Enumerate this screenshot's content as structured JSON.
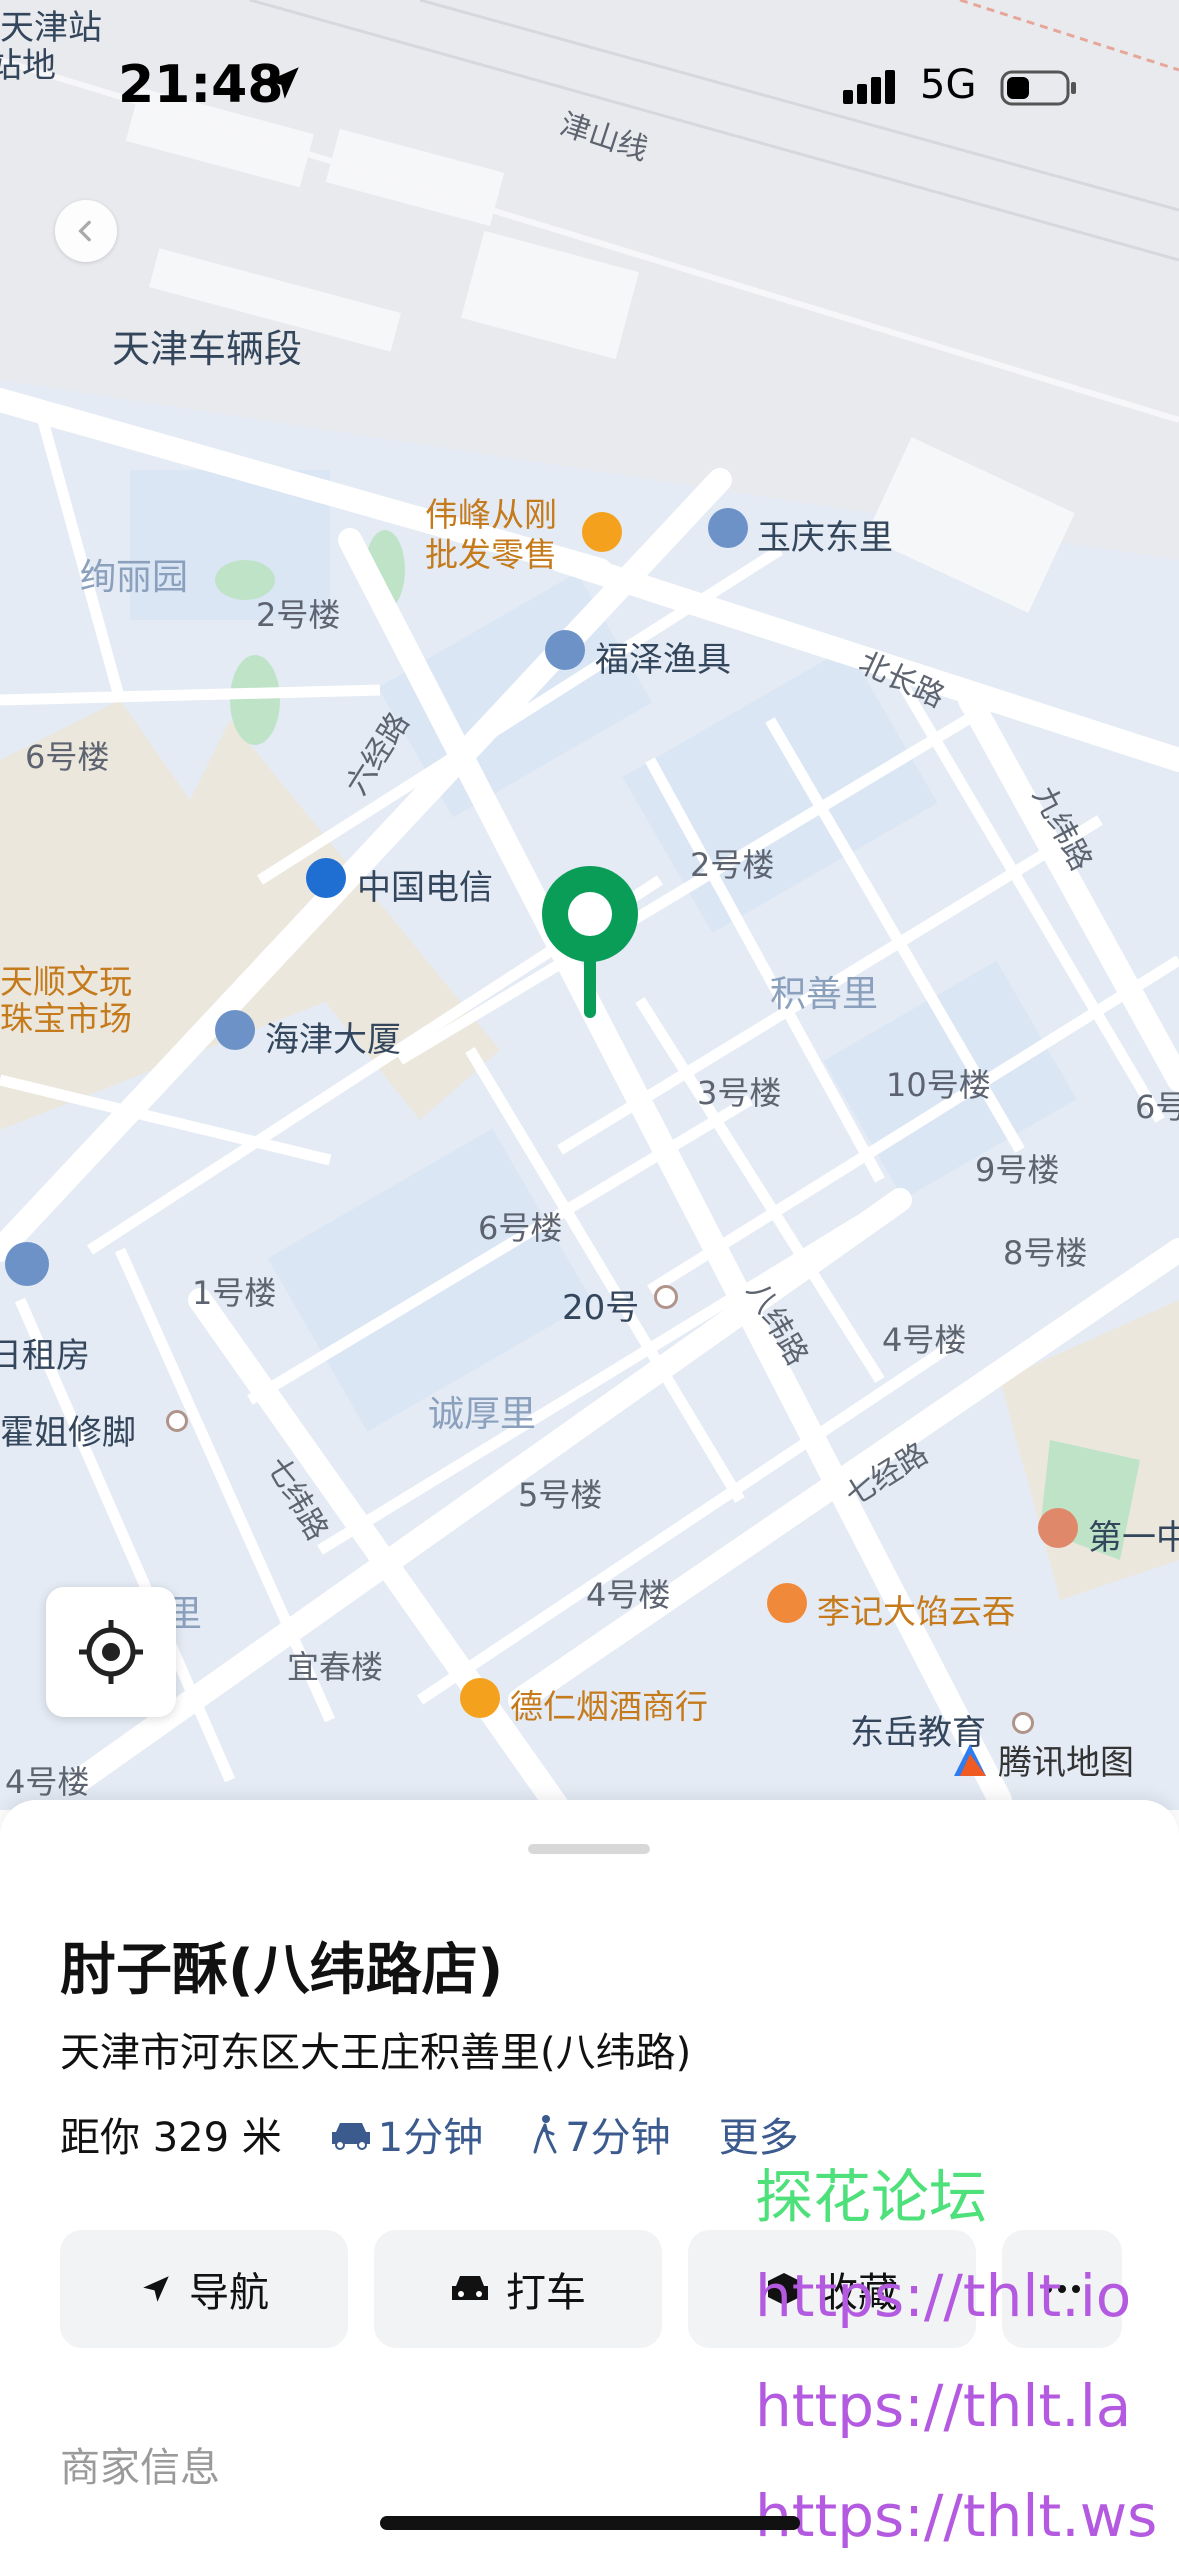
{
  "status_bar": {
    "time": "21:48",
    "network": "5G"
  },
  "map": {
    "labels": {
      "station": "天津站",
      "station_2": "站地",
      "line": "津山线",
      "depot": "天津车辆段",
      "weifeng": "伟峰从刚",
      "weifeng2": "批发零售",
      "yuqing": "玉庆东里",
      "xuliyuan": "绚丽园",
      "b2a": "2号楼",
      "fuze": "福泽渔具",
      "beichang": "北长路",
      "b6a": "6号楼",
      "liujing": "六经路",
      "jiuwei": "九纬路",
      "b2b": "2号楼",
      "telecom": "中国电信",
      "tianshun1": "天顺文玩",
      "tianshun2": "珠宝市场",
      "jishanli": "积善里",
      "haijin": "海津大厦",
      "b3": "3号楼",
      "b10": "10号楼",
      "b6b": "6号",
      "b9": "9号楼",
      "b6c": "6号楼",
      "b8": "8号楼",
      "b1": "1号楼",
      "n20": "20号",
      "bawei": "八纬路",
      "b4a": "4号楼",
      "rizu": "日租房",
      "xiujiao": "霍姐修脚",
      "chenghou": "诚厚里",
      "qiwei": "七纬路",
      "b5": "5号楼",
      "qijing": "七经路",
      "diyi": "第一中",
      "b4b": "4号楼",
      "liji": "李记大馅云吞",
      "li": "里",
      "yichun": "宜春楼",
      "deren": "德仁烟酒商行",
      "dongyue": "东岳教育",
      "b4c": "4号楼",
      "tmap": "腾讯地图"
    }
  },
  "place": {
    "name": "肘子酥(八纬路店)",
    "address": "天津市河东区大王庄积善里(八纬路)",
    "distance": "距你 329 米",
    "drive_time": "1分钟",
    "walk_time": "7分钟",
    "more": "更多"
  },
  "actions": {
    "navigate": "导航",
    "taxi": "打车",
    "favorite": "收藏",
    "more_icon": "ellipsis-icon"
  },
  "section": {
    "merchant_info": "商家信息"
  },
  "watermark": {
    "forum": "探花论坛",
    "url1": "https://thlt.io",
    "url2": "https://thlt.la",
    "url3": "https://thlt.ws"
  },
  "colors": {
    "accent_blue": "#3b5a8e",
    "pin_green": "#0a9d58",
    "poi_orange": "#c57a1b"
  }
}
